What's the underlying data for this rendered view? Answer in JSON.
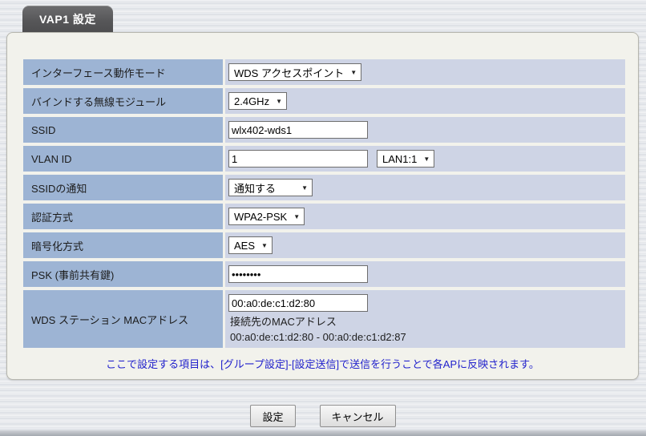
{
  "tab": {
    "title": "VAP1 設定"
  },
  "form": {
    "rows": [
      {
        "label": "インターフェース動作モード",
        "type": "select",
        "value": "WDS アクセスポイント"
      },
      {
        "label": "バインドする無線モジュール",
        "type": "select",
        "value": "2.4GHz"
      },
      {
        "label": "SSID",
        "type": "text",
        "value": "wlx402-wds1"
      },
      {
        "label": "VLAN ID",
        "type": "text+select",
        "value": "1",
        "value2": "LAN1:1"
      },
      {
        "label": "SSIDの通知",
        "type": "select",
        "value": "通知する"
      },
      {
        "label": "認証方式",
        "type": "select",
        "value": "WPA2-PSK"
      },
      {
        "label": "暗号化方式",
        "type": "select",
        "value": "AES"
      },
      {
        "label": "PSK (事前共有鍵)",
        "type": "password",
        "value": "••••••••"
      },
      {
        "label": "WDS ステーション MACアドレス",
        "type": "text",
        "value": "00:a0:de:c1:d2:80",
        "helper1": "接続先のMACアドレス",
        "helper2": "00:a0:de:c1:d2:80 - 00:a0:de:c1:d2:87"
      }
    ]
  },
  "note": "ここで設定する項目は、[グループ設定]-[設定送信]で送信を行うことで各APに反映されます。",
  "buttons": {
    "submit": "設定",
    "cancel": "キャンセル"
  },
  "icons": {
    "chevron_down": "▼"
  },
  "colors": {
    "label_cell": "#9db4d4",
    "value_cell": "#ced4e5",
    "panel_bg": "#f2f2ec",
    "tab_bg": "#565658",
    "note_text": "#2222cc"
  }
}
